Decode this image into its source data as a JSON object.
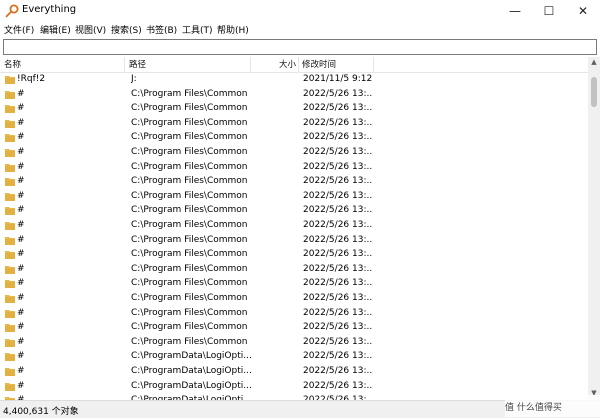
{
  "window": {
    "title": "Everything",
    "icon": "magnifier-key-icon",
    "minimize_symbol": "—",
    "maximize_symbol": "☐",
    "close_symbol": "✕"
  },
  "menu": [
    {
      "label": "文件(F)"
    },
    {
      "label": "编辑(E)"
    },
    {
      "label": "视图(V)"
    },
    {
      "label": "搜索(S)"
    },
    {
      "label": "书签(B)"
    },
    {
      "label": "工具(T)"
    },
    {
      "label": "帮助(H)"
    }
  ],
  "search": {
    "value": "",
    "placeholder": ""
  },
  "columns": {
    "name": "名称",
    "path": "路径",
    "size": "大小",
    "modified": "修改时间"
  },
  "rows": [
    {
      "name": "!Rqf!2",
      "path": "J:",
      "size": "",
      "modified": "2021/11/5 9:12"
    },
    {
      "name": "#",
      "path": "C:\\Program Files\\Common ...",
      "size": "",
      "modified": "2022/5/26 13:..."
    },
    {
      "name": "#",
      "path": "C:\\Program Files\\Common ...",
      "size": "",
      "modified": "2022/5/26 13:..."
    },
    {
      "name": "#",
      "path": "C:\\Program Files\\Common ...",
      "size": "",
      "modified": "2022/5/26 13:..."
    },
    {
      "name": "#",
      "path": "C:\\Program Files\\Common ...",
      "size": "",
      "modified": "2022/5/26 13:..."
    },
    {
      "name": "#",
      "path": "C:\\Program Files\\Common ...",
      "size": "",
      "modified": "2022/5/26 13:..."
    },
    {
      "name": "#",
      "path": "C:\\Program Files\\Common ...",
      "size": "",
      "modified": "2022/5/26 13:..."
    },
    {
      "name": "#",
      "path": "C:\\Program Files\\Common ...",
      "size": "",
      "modified": "2022/5/26 13:..."
    },
    {
      "name": "#",
      "path": "C:\\Program Files\\Common ...",
      "size": "",
      "modified": "2022/5/26 13:..."
    },
    {
      "name": "#",
      "path": "C:\\Program Files\\Common ...",
      "size": "",
      "modified": "2022/5/26 13:..."
    },
    {
      "name": "#",
      "path": "C:\\Program Files\\Common ...",
      "size": "",
      "modified": "2022/5/26 13:..."
    },
    {
      "name": "#",
      "path": "C:\\Program Files\\Common ...",
      "size": "",
      "modified": "2022/5/26 13:..."
    },
    {
      "name": "#",
      "path": "C:\\Program Files\\Common ...",
      "size": "",
      "modified": "2022/5/26 13:..."
    },
    {
      "name": "#",
      "path": "C:\\Program Files\\Common ...",
      "size": "",
      "modified": "2022/5/26 13:..."
    },
    {
      "name": "#",
      "path": "C:\\Program Files\\Common ...",
      "size": "",
      "modified": "2022/5/26 13:..."
    },
    {
      "name": "#",
      "path": "C:\\Program Files\\Common ...",
      "size": "",
      "modified": "2022/5/26 13:..."
    },
    {
      "name": "#",
      "path": "C:\\Program Files\\Common ...",
      "size": "",
      "modified": "2022/5/26 13:..."
    },
    {
      "name": "#",
      "path": "C:\\Program Files\\Common ...",
      "size": "",
      "modified": "2022/5/26 13:..."
    },
    {
      "name": "#",
      "path": "C:\\Program Files\\Common ...",
      "size": "",
      "modified": "2022/5/26 13:..."
    },
    {
      "name": "#",
      "path": "C:\\ProgramData\\LogiOpti...",
      "size": "",
      "modified": "2022/5/26 13:..."
    },
    {
      "name": "#",
      "path": "C:\\ProgramData\\LogiOpti...",
      "size": "",
      "modified": "2022/5/26 13:..."
    },
    {
      "name": "#",
      "path": "C:\\ProgramData\\LogiOpti...",
      "size": "",
      "modified": "2022/5/26 13:..."
    },
    {
      "name": "#",
      "path": "C:\\ProgramData\\LogiOpti...",
      "size": "",
      "modified": "2022/5/26 13:..."
    }
  ],
  "status": {
    "text": "4,400,631 个对象"
  },
  "watermark": {
    "text": "值 什么值得买"
  },
  "colors": {
    "folder": "#e8b84a",
    "folder_dark": "#d9a233",
    "accent": "#d4701f"
  }
}
